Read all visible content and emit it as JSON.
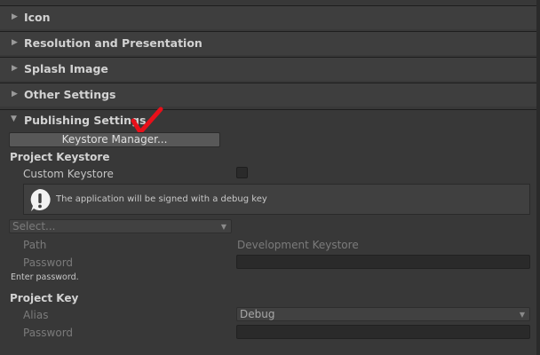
{
  "sections": {
    "icon": "Icon",
    "resolution": "Resolution and Presentation",
    "splash": "Splash Image",
    "other": "Other Settings",
    "publishing": "Publishing Settings"
  },
  "publishing": {
    "keystore_manager_button": "Keystore Manager...",
    "project_keystore_heading": "Project Keystore",
    "custom_keystore_label": "Custom Keystore",
    "custom_keystore_checked": false,
    "help_message": "The application will be signed with a debug key",
    "keystore_select_value": "Select...",
    "path_label": "Path",
    "path_value": "Development Keystore",
    "password_label": "Password",
    "keystore_password_value": "",
    "enter_password_hint": "Enter password.",
    "project_key_heading": "Project Key",
    "alias_label": "Alias",
    "alias_value": "Debug",
    "key_password_label": "Password",
    "key_password_value": ""
  },
  "colors": {
    "panel_bg": "#383838",
    "foldout_bg": "#3e3e3e",
    "annotation_mark": "#e8101a"
  },
  "icons": {
    "foldout_collapsed": "triangle-right-icon",
    "foldout_expanded": "triangle-down-icon",
    "help_info": "exclamation-icon",
    "dropdown": "chevron-down-icon",
    "annotation": "red-checkmark-icon"
  }
}
